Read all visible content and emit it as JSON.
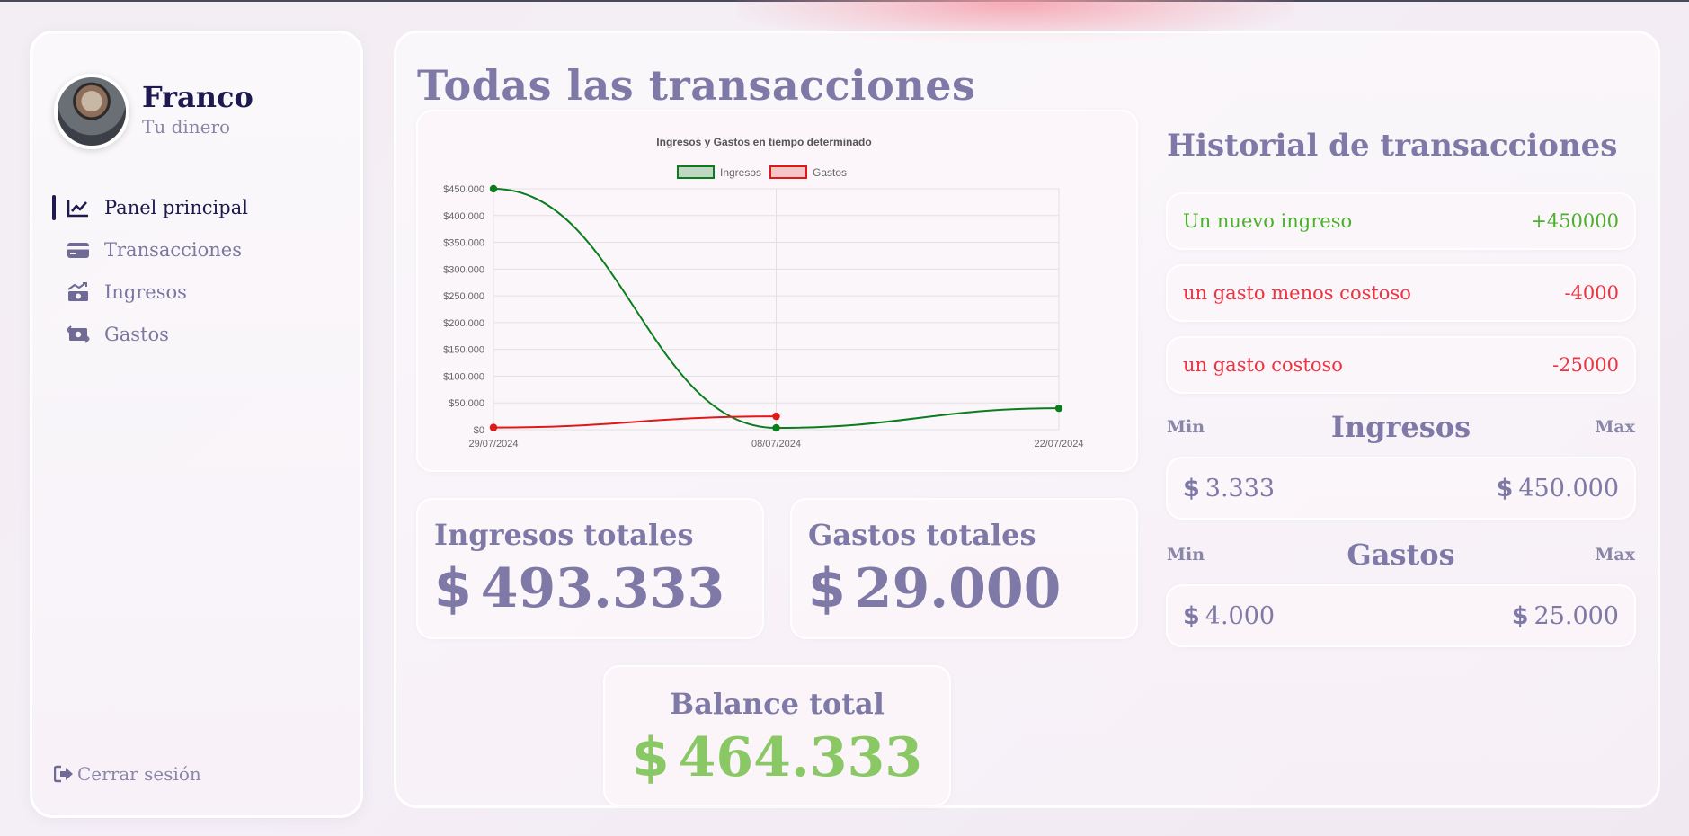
{
  "user": {
    "name": "Franco",
    "subtitle": "Tu dinero"
  },
  "sidebar": {
    "items": [
      {
        "label": "Panel principal",
        "icon": "chart-line-icon",
        "active": true
      },
      {
        "label": "Transacciones",
        "icon": "credit-card-icon"
      },
      {
        "label": "Ingresos",
        "icon": "money-bill-trend-up-icon"
      },
      {
        "label": "Gastos",
        "icon": "money-bill-transfer-icon"
      }
    ],
    "logout_label": "Cerrar sesión"
  },
  "page": {
    "title": "Todas las transacciones"
  },
  "chart_data": {
    "type": "line",
    "title": "Ingresos y Gastos en tiempo determinado",
    "x": [
      "29/07/2024",
      "08/07/2024",
      "22/07/2024"
    ],
    "series": [
      {
        "name": "Ingresos",
        "values": [
          450000,
          3333,
          40000
        ],
        "color": "#0a7d1e"
      },
      {
        "name": "Gastos",
        "values": [
          4000,
          25000,
          null
        ],
        "color": "#e01818"
      }
    ],
    "y_ticks": [
      "$450.000",
      "$400.000",
      "$350.000",
      "$300.000",
      "$250.000",
      "$200.000",
      "$150.000",
      "$100.000",
      "$50.000",
      "$0"
    ],
    "ylim": [
      0,
      450000
    ],
    "grid": true,
    "legend": "top-center"
  },
  "totals": {
    "ingresos_title": "Ingresos totales",
    "ingresos_value": "493.333",
    "gastos_title": "Gastos totales",
    "gastos_value": "29.000",
    "balance_title": "Balance total",
    "balance_value": "464.333",
    "currency": "$"
  },
  "history": {
    "title": "Historial de transacciones",
    "items": [
      {
        "description": "Un nuevo ingreso",
        "amount": "+450000",
        "type": "ingreso"
      },
      {
        "description": "un gasto menos costoso",
        "amount": "-4000",
        "type": "gasto"
      },
      {
        "description": "un gasto costoso",
        "amount": "-25000",
        "type": "gasto"
      }
    ]
  },
  "ranges": {
    "min_label": "Min",
    "max_label": "Max",
    "ingresos": {
      "title": "Ingresos",
      "min": "3.333",
      "max": "450.000"
    },
    "gastos": {
      "title": "Gastos",
      "min": "4.000",
      "max": "25.000"
    }
  },
  "colors": {
    "accent": "#7f79a8",
    "dark": "#1d1a4f",
    "positive": "#4caf2e",
    "negative": "#ef3340",
    "balance": "#8ac866"
  }
}
